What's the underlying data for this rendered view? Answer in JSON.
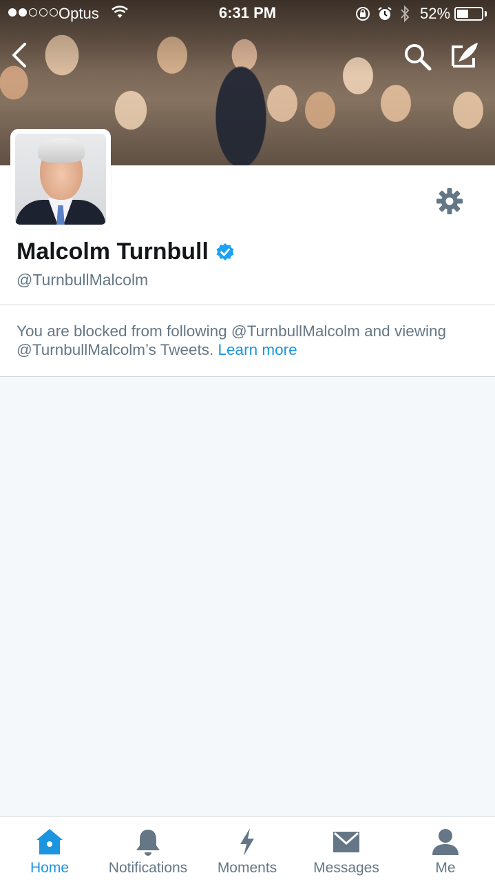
{
  "status_bar": {
    "carrier": "Optus",
    "time": "6:31 PM",
    "battery_percent": "52%",
    "battery_level": 0.52,
    "signal_bars_filled": 2,
    "signal_bars_total": 5
  },
  "nav": {
    "back_icon": "chevron-left-icon",
    "search_icon": "search-icon",
    "compose_icon": "compose-tweet-icon"
  },
  "profile": {
    "name": "Malcolm Turnbull",
    "handle": "@TurnbullMalcolm",
    "verified": true,
    "settings_icon": "gear-icon"
  },
  "blocked_notice": {
    "text": "You are blocked from following @TurnbullMalcolm and viewing @TurnbullMalcolm’s Tweets. ",
    "link": "Learn more"
  },
  "tabs": [
    {
      "label": "Home",
      "icon": "home-icon",
      "active": true
    },
    {
      "label": "Notifications",
      "icon": "bell-icon",
      "active": false
    },
    {
      "label": "Moments",
      "icon": "lightning-icon",
      "active": false
    },
    {
      "label": "Messages",
      "icon": "envelope-icon",
      "active": false
    },
    {
      "label": "Me",
      "icon": "person-icon",
      "active": false
    }
  ],
  "colors": {
    "accent": "#1b95e0",
    "muted_text": "#657786",
    "verified": "#1da1f2",
    "background": "#f5f8fa"
  }
}
